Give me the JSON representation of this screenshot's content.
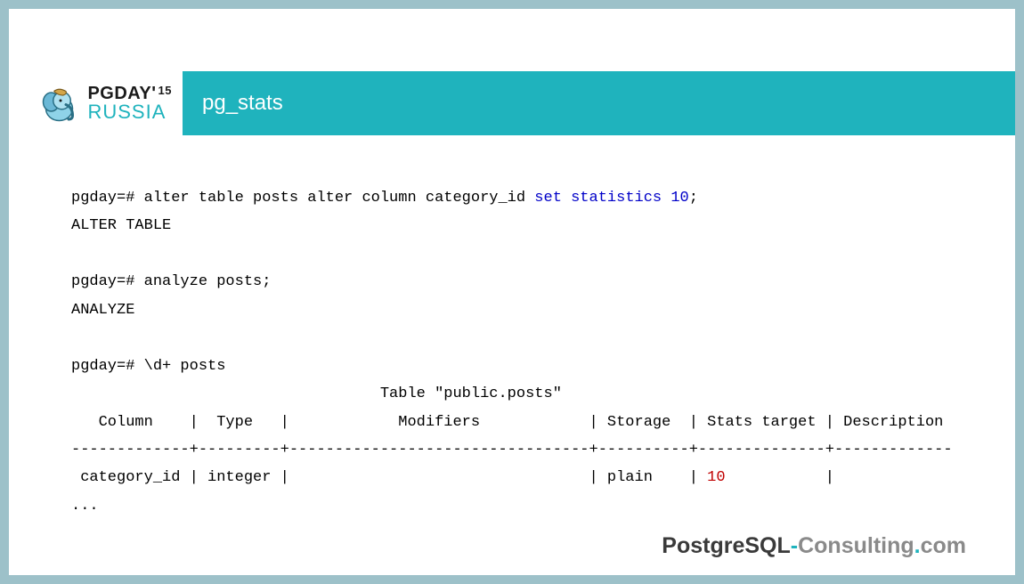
{
  "logo": {
    "top": "PGDAY",
    "apostrophe": "'",
    "year": "15",
    "bottom": "RUSSIA"
  },
  "title": "pg_stats",
  "code": {
    "l1a": "pgday=# alter table posts alter column category_id ",
    "l1b": "set statistics 10",
    "l1c": ";",
    "l2": "ALTER TABLE",
    "l3": "",
    "l4": "pgday=# analyze posts;",
    "l5": "ANALYZE",
    "l6": "",
    "l7": "pgday=# \\d+ posts",
    "l8": "                                  Table \"public.posts\"",
    "l9": "   Column    |  Type   |            Modifiers            | Storage  | Stats target | Description",
    "l10": "-------------+---------+---------------------------------+----------+--------------+-------------",
    "l11a": " category_id | integer |                                 | plain    | ",
    "l11b": "10",
    "l11c": "           |",
    "l12": "..."
  },
  "footer": {
    "a": "PostgreSQL",
    "dash": "-",
    "b": "Consulting",
    "dot": ".",
    "c": "com"
  }
}
